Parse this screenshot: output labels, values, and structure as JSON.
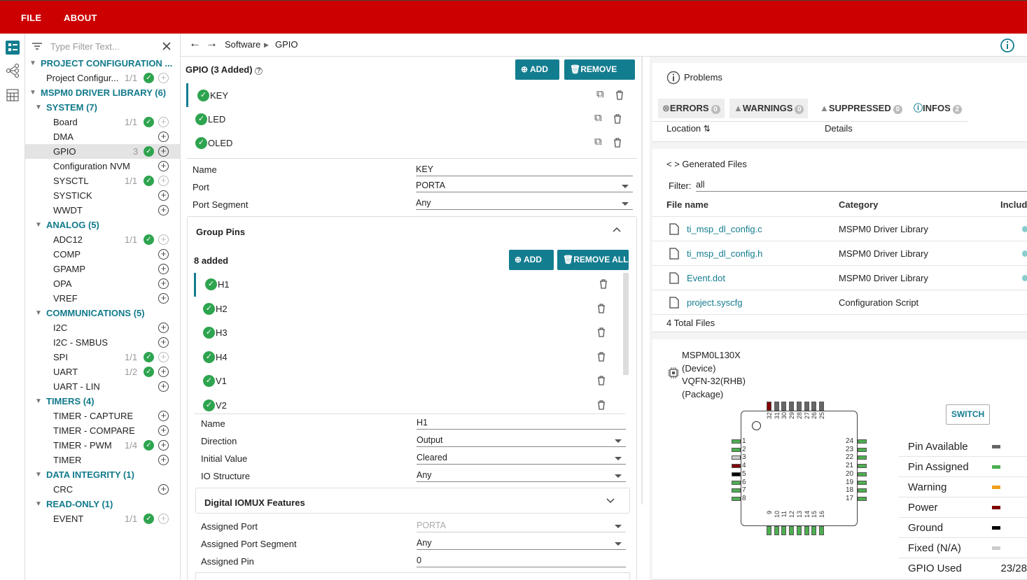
{
  "menu": {
    "file": "FILE",
    "about": "ABOUT"
  },
  "colors": {
    "brand": "#cc0000",
    "accent": "#137d90",
    "ok": "#2ea44f",
    "assigned": "#4caf50",
    "power": "#800000",
    "warning": "#f0a020",
    "ground": "#000000",
    "fixed": "#cccccc",
    "available": "#666666"
  },
  "filter": {
    "placeholder": "Type Filter Text..."
  },
  "tree": [
    {
      "type": "sec",
      "label": "PROJECT CONFIGURATION ...",
      "indent": 0
    },
    {
      "type": "item",
      "label": "Project Configur...",
      "count": "1/1",
      "ok": true,
      "plus": "dis",
      "indent": 1,
      "x": 30
    },
    {
      "type": "sec",
      "label": "MSPM0 DRIVER LIBRARY (6)",
      "indent": 0
    },
    {
      "type": "sec",
      "label": "SYSTEM (7)",
      "indent": 1
    },
    {
      "type": "item",
      "label": "Board",
      "count": "1/1",
      "ok": true,
      "plus": "dis",
      "x": 40
    },
    {
      "type": "item",
      "label": "DMA",
      "count": "",
      "ok": false,
      "plus": "on",
      "x": 40
    },
    {
      "type": "item",
      "label": "GPIO",
      "count": "3",
      "ok": true,
      "plus": "on",
      "x": 40,
      "sel": true
    },
    {
      "type": "item",
      "label": "Configuration NVM",
      "count": "",
      "ok": false,
      "plus": "on",
      "x": 40
    },
    {
      "type": "item",
      "label": "SYSCTL",
      "count": "1/1",
      "ok": true,
      "plus": "dis",
      "x": 40
    },
    {
      "type": "item",
      "label": "SYSTICK",
      "count": "",
      "ok": false,
      "plus": "on",
      "x": 40
    },
    {
      "type": "item",
      "label": "WWDT",
      "count": "",
      "ok": false,
      "plus": "on",
      "x": 40
    },
    {
      "type": "sec",
      "label": "ANALOG (5)",
      "indent": 1
    },
    {
      "type": "item",
      "label": "ADC12",
      "count": "1/1",
      "ok": true,
      "plus": "dis",
      "x": 40
    },
    {
      "type": "item",
      "label": "COMP",
      "count": "",
      "ok": false,
      "plus": "on",
      "x": 40
    },
    {
      "type": "item",
      "label": "GPAMP",
      "count": "",
      "ok": false,
      "plus": "on",
      "x": 40
    },
    {
      "type": "item",
      "label": "OPA",
      "count": "",
      "ok": false,
      "plus": "on",
      "x": 40
    },
    {
      "type": "item",
      "label": "VREF",
      "count": "",
      "ok": false,
      "plus": "on",
      "x": 40
    },
    {
      "type": "sec",
      "label": "COMMUNICATIONS (5)",
      "indent": 1
    },
    {
      "type": "item",
      "label": "I2C",
      "count": "",
      "ok": false,
      "plus": "on",
      "x": 40
    },
    {
      "type": "item",
      "label": "I2C - SMBUS",
      "count": "",
      "ok": false,
      "plus": "on",
      "x": 40
    },
    {
      "type": "item",
      "label": "SPI",
      "count": "1/1",
      "ok": true,
      "plus": "dis",
      "x": 40
    },
    {
      "type": "item",
      "label": "UART",
      "count": "1/2",
      "ok": true,
      "plus": "on",
      "x": 40
    },
    {
      "type": "item",
      "label": "UART - LIN",
      "count": "",
      "ok": false,
      "plus": "on",
      "x": 40
    },
    {
      "type": "sec",
      "label": "TIMERS (4)",
      "indent": 1
    },
    {
      "type": "item",
      "label": "TIMER - CAPTURE",
      "count": "",
      "ok": false,
      "plus": "on",
      "x": 40
    },
    {
      "type": "item",
      "label": "TIMER - COMPARE",
      "count": "",
      "ok": false,
      "plus": "on",
      "x": 40
    },
    {
      "type": "item",
      "label": "TIMER - PWM",
      "count": "1/4",
      "ok": true,
      "plus": "on",
      "x": 40
    },
    {
      "type": "item",
      "label": "TIMER",
      "count": "",
      "ok": false,
      "plus": "on",
      "x": 40
    },
    {
      "type": "sec",
      "label": "DATA INTEGRITY (1)",
      "indent": 1
    },
    {
      "type": "item",
      "label": "CRC",
      "count": "",
      "ok": false,
      "plus": "on",
      "x": 40
    },
    {
      "type": "sec",
      "label": "READ-ONLY (1)",
      "indent": 1
    },
    {
      "type": "item",
      "label": "EVENT",
      "count": "1/1",
      "ok": true,
      "plus": "dis",
      "x": 40
    }
  ],
  "breadcrumb": {
    "root": "Software",
    "leaf": "GPIO"
  },
  "gpio": {
    "title": "GPIO (3 Added)",
    "add": "ADD",
    "remove_all": "REMOVE ALL",
    "instances": [
      "KEY",
      "LED",
      "OLED"
    ]
  },
  "config": {
    "name_label": "Name",
    "name_value": "KEY",
    "port_label": "Port",
    "port_value": "PORTA",
    "seg_label": "Port Segment",
    "seg_value": "Any"
  },
  "group": {
    "title": "Group Pins",
    "added": "8 added",
    "add": "ADD",
    "remove_all": "REMOVE ALL",
    "pins": [
      "H1",
      "H2",
      "H3",
      "H4",
      "V1",
      "V2"
    ]
  },
  "pin": {
    "name_label": "Name",
    "name_value": "H1",
    "dir_label": "Direction",
    "dir_value": "Output",
    "init_label": "Initial Value",
    "init_value": "Cleared",
    "io_label": "IO Structure",
    "io_value": "Any"
  },
  "iomux": {
    "title": "Digital IOMUX Features",
    "ap_label": "Assigned Port",
    "ap_value": "PORTA",
    "aps_label": "Assigned Port Segment",
    "aps_value": "Any",
    "apin_label": "Assigned Pin",
    "apin_value": "0"
  },
  "problems": {
    "title": "Problems",
    "errors": "ERRORS",
    "errors_n": "0",
    "warnings": "WARNINGS",
    "warnings_n": "0",
    "suppressed": "SUPPRESSED",
    "suppressed_n": "0",
    "infos": "INFOS",
    "infos_n": "2",
    "col_location": "Location",
    "col_details": "Details"
  },
  "generated": {
    "title": "Generated Files",
    "filter_label": "Filter:",
    "filter_value": "all",
    "col_file": "File name",
    "col_cat": "Category",
    "col_inc": "Include",
    "files": [
      {
        "name": "ti_msp_dl_config.c",
        "cat": "MSPM0 Driver Library"
      },
      {
        "name": "ti_msp_dl_config.h",
        "cat": "MSPM0 Driver Library"
      },
      {
        "name": "Event.dot",
        "cat": "MSPM0 Driver Library"
      },
      {
        "name": "project.syscfg",
        "cat": "Configuration Script"
      }
    ],
    "total": "4 Total Files"
  },
  "device": {
    "name": "MSPM0L130X",
    "dev": "(Device)",
    "pkg": "VQFN-32(RHB)",
    "pkgl": "(Package)",
    "switch": "SWITCH",
    "legend": [
      {
        "label": "Pin Available",
        "c": "#666666"
      },
      {
        "label": "Pin Assigned",
        "c": "#4caf50"
      },
      {
        "label": "Warning",
        "c": "#f0a020"
      },
      {
        "label": "Power",
        "c": "#800000"
      },
      {
        "label": "Ground",
        "c": "#000000"
      },
      {
        "label": "Fixed (N/A)",
        "c": "#cccccc"
      }
    ],
    "gpio_used_label": "GPIO Used",
    "gpio_used": "23/28"
  }
}
